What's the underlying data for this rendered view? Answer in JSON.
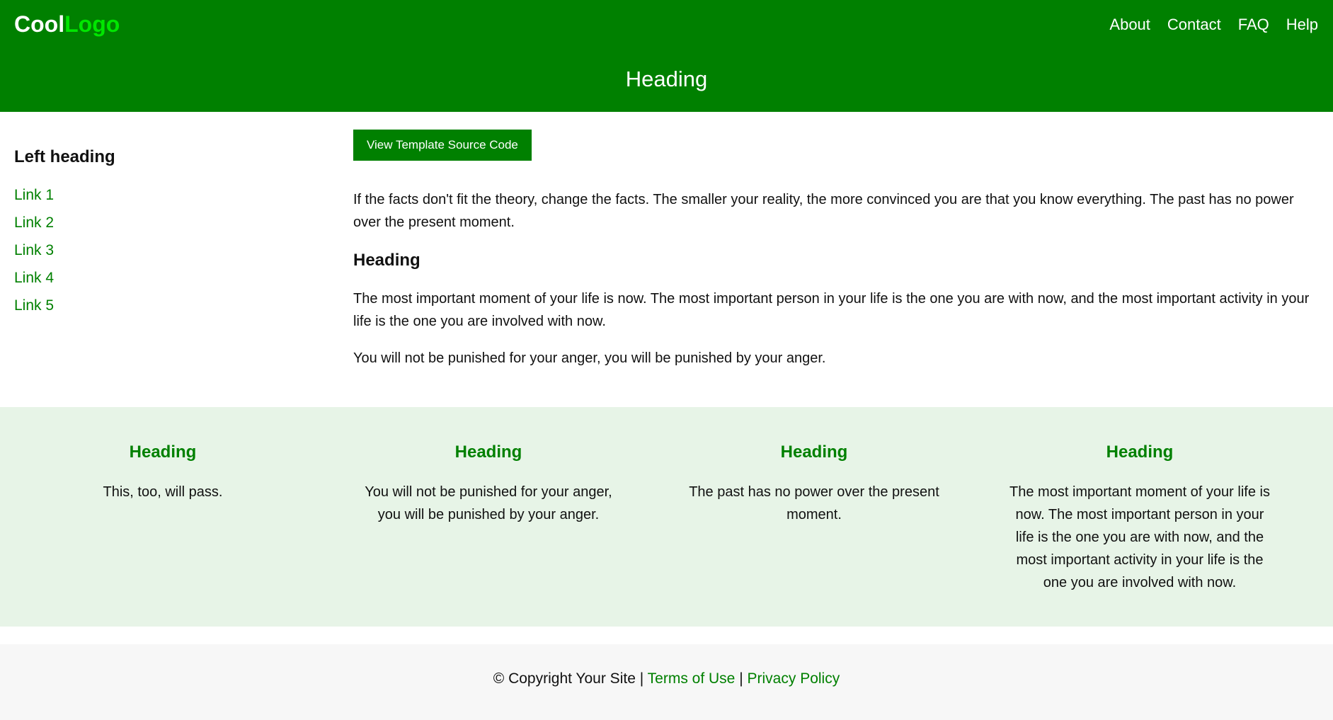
{
  "header": {
    "logo_part1": "Cool",
    "logo_part2": "Logo",
    "nav": [
      "About",
      "Contact",
      "FAQ",
      "Help"
    ],
    "banner_title": "Heading"
  },
  "sidebar": {
    "heading": "Left heading",
    "links": [
      "Link 1",
      "Link 2",
      "Link 3",
      "Link 4",
      "Link 5"
    ]
  },
  "content": {
    "button_label": "View Template Source Code",
    "paragraph1": "If the facts don't fit the theory, change the facts. The smaller your reality, the more convinced you are that you know everything. The past has no power over the present moment.",
    "heading": "Heading",
    "paragraph2": "The most important moment of your life is now. The most important person in your life is the one you are with now, and the most important activity in your life is the one you are involved with now.",
    "paragraph3": "You will not be punished for your anger, you will be punished by your anger."
  },
  "features": [
    {
      "heading": "Heading",
      "text": "This, too, will pass."
    },
    {
      "heading": "Heading",
      "text": "You will not be punished for your anger, you will be punished by your anger."
    },
    {
      "heading": "Heading",
      "text": "The past has no power over the present moment."
    },
    {
      "heading": "Heading",
      "text": "The most important moment of your life is now. The most important person in your life is the one you are with now, and the most important activity in your life is the one you are involved with now."
    }
  ],
  "footer": {
    "copyright": "© Copyright Your Site",
    "separator": "|",
    "terms_label": "Terms of Use",
    "privacy_label": "Privacy Policy"
  },
  "colors": {
    "primary_green": "#008000",
    "logo_accent": "#00e600",
    "band_background": "#e7f4e7",
    "footer_background": "#f7f7f7"
  }
}
